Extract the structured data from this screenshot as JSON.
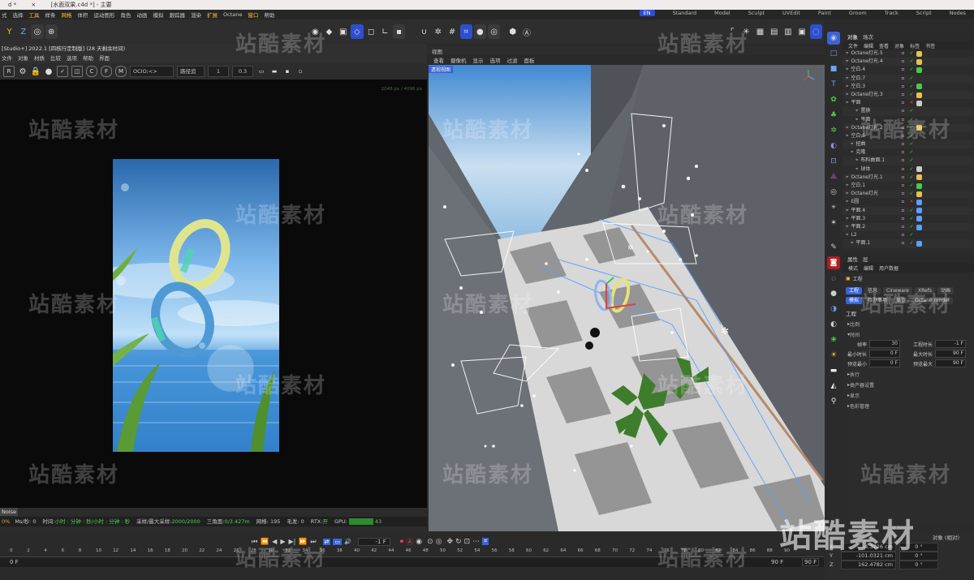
{
  "titlebar": {
    "doc_tab": "d *",
    "file_tab": "[水面双果.c4d *] - 主要"
  },
  "menubar": {
    "items": [
      "式",
      "选择",
      "工具",
      "样条",
      "网格",
      "体积",
      "运动图形",
      "角色",
      "动画",
      "模拟",
      "跟踪器",
      "渲染",
      "扩展",
      "Octane",
      "窗口",
      "帮助"
    ],
    "highlight": [
      "工具",
      "网格",
      "扩展",
      "窗口"
    ]
  },
  "layouts": {
    "items": [
      "Standard",
      "Model",
      "Sculpt",
      "UVEdit",
      "Paint",
      "Groom",
      "Track",
      "Script",
      "Nodes"
    ],
    "active_badge": "EN"
  },
  "toolbar": {
    "axis_y": "Y",
    "axis_z": "Z"
  },
  "render_panel": {
    "title": "[Studio+] 2022.1 [四核行定制版] (28 天剩余时间)",
    "menu": [
      "文件",
      "对象",
      "材质",
      "比较",
      "选项",
      "帮助",
      "界面"
    ],
    "ocio_label": "OCIO:<>",
    "path_label": "路径追",
    "value1": "1",
    "value2": "0.3",
    "corner_note": "2048 px / 4096 px",
    "noise_tab": "Noise",
    "status": {
      "pct": "0%",
      "ms": "Ms/秒: 0",
      "time_label": "时间:",
      "time_val": "小时 : 分钟 : 秒/小时 : 分钟 : 秒",
      "samples_label": "采样/最大采样:",
      "samples_val": "2000/2000",
      "tris_label": "三角面:",
      "tris_val": "0/3.427m",
      "mesh": "网格: 195",
      "hair": "毛发: 0",
      "rtx_label": "RTX:",
      "rtx_val": "开",
      "gpu_label": "GPU:",
      "gpu_val": "43"
    }
  },
  "viewport": {
    "tab": "视图",
    "menu": [
      "查看",
      "摄像机",
      "显示",
      "选项",
      "过滤",
      "面板"
    ],
    "camera_label": "透视视图"
  },
  "objects_panel": {
    "tabs": [
      "对象",
      "场次"
    ],
    "menu": [
      "文件",
      "编辑",
      "查看",
      "对象",
      "标签",
      "书签"
    ],
    "items": [
      {
        "name": "Octane灯光.5",
        "indent": 0,
        "ok": true,
        "tag": "#e8c050"
      },
      {
        "name": "Octane灯光.4",
        "indent": 0,
        "ok": true,
        "tag": "#e8c050"
      },
      {
        "name": "空白.4",
        "indent": 0,
        "ok": true,
        "tag": "#44cc44"
      },
      {
        "name": "空白.7",
        "indent": 0,
        "ok": true,
        "tag": ""
      },
      {
        "name": "空白.3",
        "indent": 0,
        "ok": true,
        "tag": "#44cc44"
      },
      {
        "name": "Octane灯光.3",
        "indent": 0,
        "ok": true,
        "tag": "#e8c050"
      },
      {
        "name": "平面",
        "indent": 0,
        "ok": false,
        "tag": "#cccccc"
      },
      {
        "name": "置换",
        "indent": 2,
        "ok": true,
        "tag": ""
      },
      {
        "name": "平面",
        "indent": 2,
        "ok": true,
        "tag": ""
      },
      {
        "name": "Octane灯光.2",
        "indent": 0,
        "ok": true,
        "tag": "#e8c050"
      },
      {
        "name": "空白.5",
        "indent": 0,
        "ok": true,
        "tag": ""
      },
      {
        "name": "扭曲",
        "indent": 1,
        "ok": true,
        "tag": ""
      },
      {
        "name": "克隆",
        "indent": 1,
        "ok": true,
        "tag": ""
      },
      {
        "name": "布料曲面.1",
        "indent": 2,
        "ok": true,
        "tag": ""
      },
      {
        "name": "球体",
        "indent": 2,
        "ok": true,
        "tag": "#cccccc"
      },
      {
        "name": "Octane灯光.1",
        "indent": 0,
        "ok": true,
        "tag": "#e8c050"
      },
      {
        "name": "空白.1",
        "indent": 0,
        "ok": true,
        "tag": "#44cc44"
      },
      {
        "name": "Octane灯光",
        "indent": 0,
        "ok": true,
        "tag": "#e8c050"
      },
      {
        "name": "E圆",
        "indent": 0,
        "ok": false,
        "tag": "#5aa0ff"
      },
      {
        "name": "平面.4",
        "indent": 0,
        "ok": true,
        "tag": "#5aa0ff"
      },
      {
        "name": "平面.3",
        "indent": 0,
        "ok": true,
        "tag": "#5aa0ff"
      },
      {
        "name": "平面.2",
        "indent": 0,
        "ok": true,
        "tag": "#5aa0ff"
      },
      {
        "name": "L2",
        "indent": 0,
        "ok": true,
        "tag": ""
      },
      {
        "name": "平面.1",
        "indent": 1,
        "ok": true,
        "tag": "#5aa0ff"
      }
    ]
  },
  "attributes_panel": {
    "tabs": [
      "属性",
      "层"
    ],
    "menu": [
      "模式",
      "编辑",
      "用户数据"
    ],
    "object_label": "工程",
    "subtabs_row1": [
      "工程",
      "信息",
      "Cineware",
      "XRefs",
      "动画"
    ],
    "subtabs_row2": [
      "模拟",
      "待办事项",
      "插值",
      "Octane render"
    ],
    "section_title": "工程",
    "sections": [
      "比例",
      "时间",
      "执行",
      "类产器设置",
      "显示",
      "色彩管理"
    ],
    "time_fields": [
      {
        "label": "帧率",
        "value": "30",
        "label2": "工程时长",
        "value2": "-1 F"
      },
      {
        "label": "最小时长",
        "value": "0 F",
        "label2": "最大时长",
        "value2": "90 F"
      },
      {
        "label": "预览最小",
        "value": "0 F",
        "label2": "预览最大",
        "value2": "90 F"
      }
    ]
  },
  "timeline": {
    "frame_field": "-1 F",
    "ticks": [
      "0",
      "2",
      "4",
      "6",
      "8",
      "10",
      "12",
      "14",
      "16",
      "18",
      "20",
      "22",
      "24",
      "26",
      "28",
      "30",
      "32",
      "34",
      "36",
      "38",
      "40",
      "42",
      "44",
      "46",
      "48",
      "50",
      "52",
      "54",
      "56",
      "58",
      "60",
      "62",
      "64",
      "66",
      "68",
      "70",
      "72",
      "74",
      "76",
      "78",
      "80",
      "82",
      "84",
      "86",
      "88",
      "90"
    ],
    "start": "0 F",
    "end1": "90 F",
    "end2": "90 F"
  },
  "coordinates": {
    "header": "对象 (相对)",
    "rows": [
      {
        "axis": "X",
        "pos": "-4.3726 cm",
        "rot": "0 °"
      },
      {
        "axis": "Y",
        "pos": "-101.0321 cm",
        "rot": "0 °"
      },
      {
        "axis": "Z",
        "pos": "162.4782 cm",
        "rot": "0 °"
      }
    ]
  },
  "watermark": {
    "text": "站酷素材"
  },
  "colors": {
    "accent_blue": "#3a64d8",
    "ok_green": "#4fd04f",
    "menu_highlight": "#f3c03a"
  }
}
